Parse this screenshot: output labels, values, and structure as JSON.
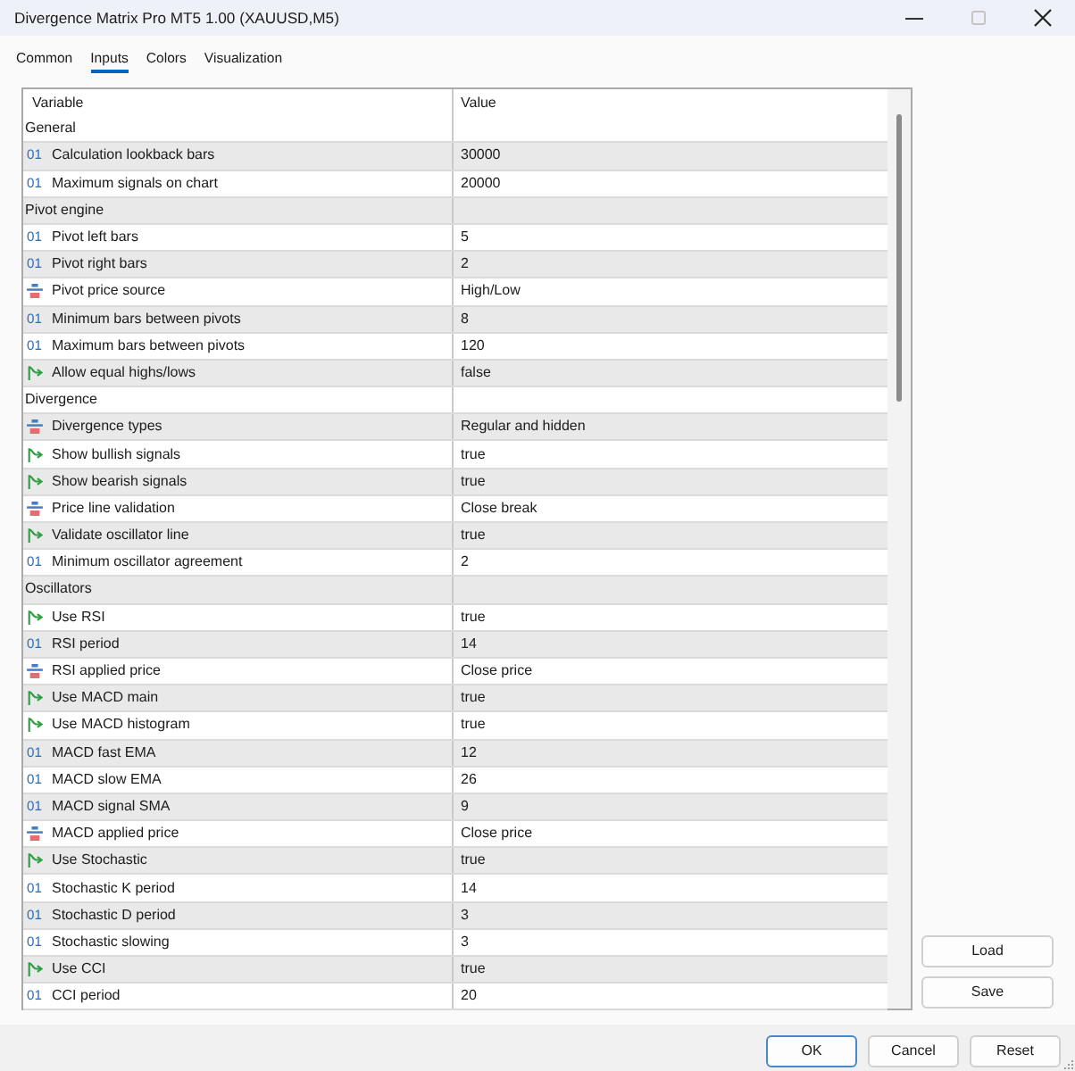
{
  "window": {
    "title": "Divergence Matrix Pro MT5 1.00 (XAUUSD,M5)",
    "maximize_disabled": true
  },
  "tabs": [
    {
      "label": "Common",
      "selected": false
    },
    {
      "label": "Inputs",
      "selected": true
    },
    {
      "label": "Colors",
      "selected": false
    },
    {
      "label": "Visualization",
      "selected": false
    }
  ],
  "table": {
    "columns": [
      "Variable",
      "Value"
    ],
    "rows": [
      {
        "kind": "group",
        "label": "General"
      },
      {
        "kind": "integer",
        "type_mark": "01",
        "label": "Calculation lookback bars",
        "value": "30000"
      },
      {
        "kind": "integer",
        "type_mark": "01",
        "label": "Maximum signals on chart",
        "value": "20000"
      },
      {
        "kind": "group",
        "label": "Pivot engine"
      },
      {
        "kind": "integer",
        "type_mark": "01",
        "label": "Pivot left bars",
        "value": "5"
      },
      {
        "kind": "integer",
        "type_mark": "01",
        "label": "Pivot right bars",
        "value": "2"
      },
      {
        "kind": "enum",
        "label": "Pivot price source",
        "value": "High/Low"
      },
      {
        "kind": "integer",
        "type_mark": "01",
        "label": "Minimum bars between pivots",
        "value": "8"
      },
      {
        "kind": "integer",
        "type_mark": "01",
        "label": "Maximum bars between pivots",
        "value": "120"
      },
      {
        "kind": "boolean",
        "label": "Allow equal highs/lows",
        "value": "false"
      },
      {
        "kind": "group",
        "label": "Divergence"
      },
      {
        "kind": "enum",
        "label": "Divergence types",
        "value": "Regular and hidden"
      },
      {
        "kind": "boolean",
        "label": "Show bullish signals",
        "value": "true"
      },
      {
        "kind": "boolean",
        "label": "Show bearish signals",
        "value": "true"
      },
      {
        "kind": "enum",
        "label": "Price line validation",
        "value": "Close break"
      },
      {
        "kind": "boolean",
        "label": "Validate oscillator line",
        "value": "true"
      },
      {
        "kind": "integer",
        "type_mark": "01",
        "label": "Minimum oscillator agreement",
        "value": "2"
      },
      {
        "kind": "group",
        "label": "Oscillators"
      },
      {
        "kind": "boolean",
        "label": "Use RSI",
        "value": "true"
      },
      {
        "kind": "integer",
        "type_mark": "01",
        "label": "RSI period",
        "value": "14"
      },
      {
        "kind": "enum",
        "label": "RSI applied price",
        "value": "Close price"
      },
      {
        "kind": "boolean",
        "label": "Use MACD main",
        "value": "true"
      },
      {
        "kind": "boolean",
        "label": "Use MACD histogram",
        "value": "true"
      },
      {
        "kind": "integer",
        "type_mark": "01",
        "label": "MACD fast EMA",
        "value": "12"
      },
      {
        "kind": "integer",
        "type_mark": "01",
        "label": "MACD slow EMA",
        "value": "26"
      },
      {
        "kind": "integer",
        "type_mark": "01",
        "label": "MACD signal SMA",
        "value": "9"
      },
      {
        "kind": "enum",
        "label": "MACD applied price",
        "value": "Close price"
      },
      {
        "kind": "boolean",
        "label": "Use Stochastic",
        "value": "true"
      },
      {
        "kind": "integer",
        "type_mark": "01",
        "label": "Stochastic K period",
        "value": "14"
      },
      {
        "kind": "integer",
        "type_mark": "01",
        "label": "Stochastic D period",
        "value": "3"
      },
      {
        "kind": "integer",
        "type_mark": "01",
        "label": "Stochastic slowing",
        "value": "3"
      },
      {
        "kind": "boolean",
        "label": "Use CCI",
        "value": "true"
      },
      {
        "kind": "integer",
        "type_mark": "01",
        "label": "CCI period",
        "value": "20"
      }
    ]
  },
  "side_buttons": [
    "Load",
    "Save"
  ],
  "buttons": [
    {
      "label": "OK",
      "default": true
    },
    {
      "label": "Cancel",
      "default": false
    },
    {
      "label": "Reset",
      "default": false
    }
  ]
}
